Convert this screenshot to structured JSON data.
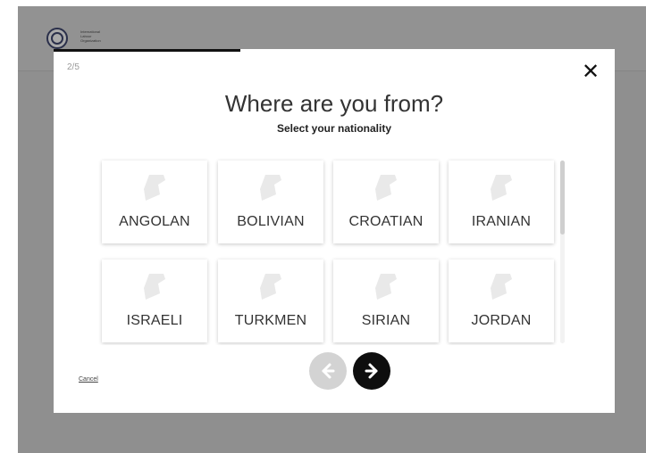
{
  "org": {
    "logo_text_lines": [
      "International",
      "Labour",
      "Organization"
    ]
  },
  "modal": {
    "step": "2/5",
    "progress": 0.333,
    "title": "Where are you from?",
    "subtitle": "Select your nationality",
    "close_icon": "close-icon",
    "cancel_label": "Cancel"
  },
  "nationalities": [
    {
      "label": "ANGOLAN"
    },
    {
      "label": "BOLIVIAN"
    },
    {
      "label": "CROATIAN"
    },
    {
      "label": "IRANIAN"
    },
    {
      "label": "ISRAELI"
    },
    {
      "label": "TURKMEN"
    },
    {
      "label": "SIRIAN"
    },
    {
      "label": "JORDAN"
    }
  ],
  "colors": {
    "backdrop": "#8f8f8f",
    "flag_placeholder": "#e9e9e9",
    "next_button": "#0e0e0e",
    "prev_button_disabled": "#d3d3d3"
  }
}
